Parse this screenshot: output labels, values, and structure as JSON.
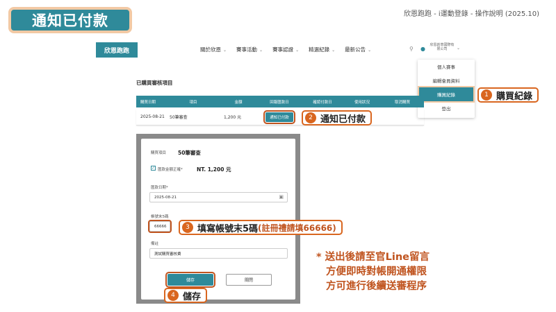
{
  "slide_title": "通知已付款",
  "top_caption": "欣恩跑跑 - i運動登錄 - 操作說明 (2025.10)",
  "brand": "欣恩跑跑",
  "nav": [
    {
      "label": "關於欣恩"
    },
    {
      "label": "賽事活動"
    },
    {
      "label": "賽事認證"
    },
    {
      "label": "精選紀錄"
    },
    {
      "label": "最新公告"
    }
  ],
  "user_name": "欣恩創意國際有限公司",
  "dropdown": [
    "個人賽事",
    "編輯會員資料",
    "購買紀錄",
    "登出"
  ],
  "section_title": "已購買審核項目",
  "table": {
    "headers": [
      "購買日期",
      "項目",
      "金額",
      "回報匯款日",
      "確認付款日",
      "使用狀況",
      "取消購買"
    ],
    "row": {
      "date": "2025-08-21",
      "item": "50筆審查",
      "amount": "1,200 元",
      "notify_button": "通知已付款"
    }
  },
  "modal": {
    "item_label": "購買項目",
    "item_name": "50筆審查",
    "confirm_label": "匯款金額正確*",
    "amount": "NT. 1,200 元",
    "date_label": "匯款日期*",
    "date_value": "2025-08-21",
    "account_label": "帳號末5碼",
    "account_value": "66666",
    "remark_label": "備註",
    "remark_value": "測試購買審核費",
    "save_label": "儲存",
    "close_label": "關閉"
  },
  "callouts": [
    {
      "num": "1",
      "text": "購買紀錄"
    },
    {
      "num": "2",
      "text": "通知已付款"
    },
    {
      "num": "3",
      "text": "填寫帳號末5碼 ",
      "highlight": "(註冊禮請填66666)"
    },
    {
      "num": "4",
      "text": "儲存"
    }
  ],
  "note": [
    "* 送出後請至官Line留言",
    "方便即時對帳開通權限",
    "方可進行後續送審程序"
  ],
  "colors": {
    "primary": "#2f8a9a",
    "accent": "#d9661f",
    "title_border": "#f2c9a4"
  }
}
